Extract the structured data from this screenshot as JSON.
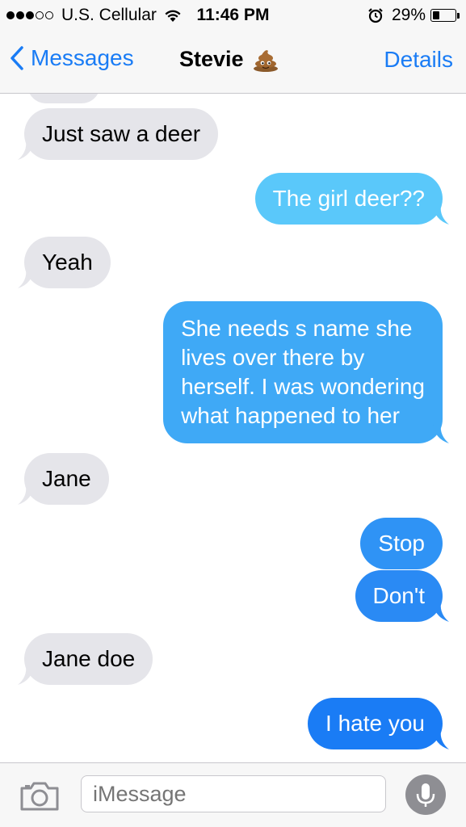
{
  "status_bar": {
    "carrier": "U.S. Cellular",
    "time": "11:46 PM",
    "battery_percent": "29%",
    "signal_bars_filled": 3,
    "signal_bars_total": 5,
    "battery_level": 0.29
  },
  "nav": {
    "back_label": "Messages",
    "title": "Stevie",
    "title_emoji": "pile-of-poo-emoji",
    "details_label": "Details"
  },
  "messages": [
    {
      "direction": "incoming",
      "text": "Just saw a deer"
    },
    {
      "direction": "outgoing",
      "text": "The girl deer??"
    },
    {
      "direction": "incoming",
      "text": "Yeah"
    },
    {
      "direction": "outgoing",
      "lines": [
        "She needs s name she",
        "lives over there by",
        "herself. I was wondering",
        "what happened to her"
      ]
    },
    {
      "direction": "incoming",
      "text": "Jane"
    },
    {
      "direction": "outgoing",
      "text": "Stop"
    },
    {
      "direction": "outgoing",
      "text": "Don't"
    },
    {
      "direction": "incoming",
      "text": "Jane doe"
    },
    {
      "direction": "outgoing",
      "text": "I hate you"
    }
  ],
  "input": {
    "placeholder": "iMessage"
  },
  "colors": {
    "ios_blue": "#1a7cf5",
    "incoming_bubble": "#e5e5ea",
    "outgoing_gradient_top": "#5ac8fa",
    "outgoing_gradient_bottom": "#1a7cf5",
    "mic_gray": "#8e8e93"
  }
}
